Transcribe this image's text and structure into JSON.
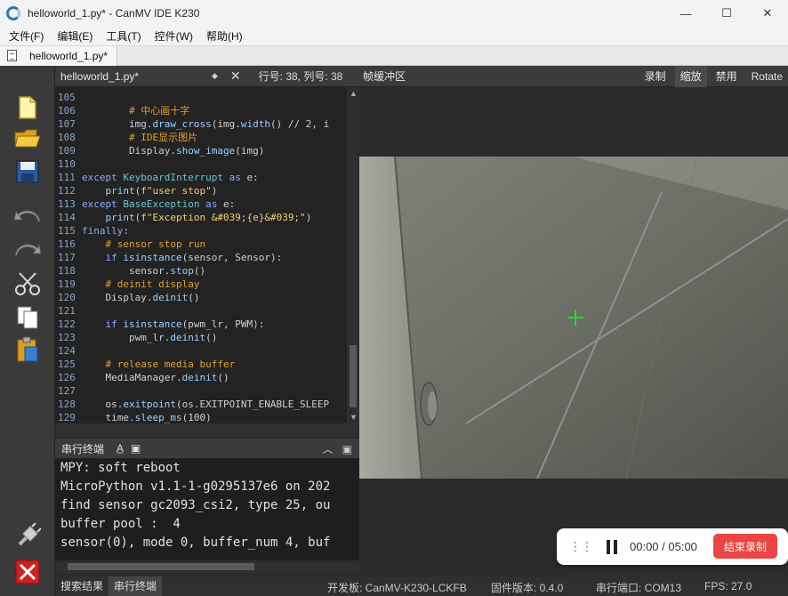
{
  "window": {
    "title": "helloworld_1.py* - CanMV IDE K230",
    "controls": {
      "minimize": "—",
      "maximize": "☐",
      "close": "✕"
    }
  },
  "menu": [
    {
      "label": "文件(F)"
    },
    {
      "label": "编辑(E)"
    },
    {
      "label": "工具(T)"
    },
    {
      "label": "控件(W)"
    },
    {
      "label": "帮助(H)"
    }
  ],
  "doc_tab": {
    "label": "helloworld_1.py*"
  },
  "editor": {
    "file_label": "helloworld_1.py*",
    "dropdown": "◆",
    "close": "✕",
    "position": "行号: 38, 列号: 38"
  },
  "code_lines": [
    {
      "n": "105",
      "html": ""
    },
    {
      "n": "106",
      "html": "        <span class='cm'># 中心画十字</span>"
    },
    {
      "n": "107",
      "html": "        img.<span class='fn'>draw_cross</span>(img.<span class='fn'>width</span>() // 2, i"
    },
    {
      "n": "108",
      "html": "        <span class='cm'># IDE显示图片</span>"
    },
    {
      "n": "109",
      "html": "        Display.<span class='fn'>show_image</span>(img)"
    },
    {
      "n": "110",
      "html": ""
    },
    {
      "n": "111",
      "html": "<span class='kw'>except</span> <span class='cls'>KeyboardInterrupt</span> <span class='kw'>as</span> e:"
    },
    {
      "n": "112",
      "html": "    <span class='fn'>print</span>(<span class='st'>f\"user stop\"</span>)"
    },
    {
      "n": "113",
      "html": "<span class='kw'>except</span> <span class='cls'>BaseException</span> <span class='kw'>as</span> e:"
    },
    {
      "n": "114",
      "html": "    <span class='fn'>print</span>(<span class='st'>f\"Exception &amp;#039;{e}&amp;#039;\"</span>)"
    },
    {
      "n": "115",
      "html": "<span class='kw'>finally</span>:"
    },
    {
      "n": "116",
      "html": "    <span class='cm'># sensor stop run</span>"
    },
    {
      "n": "117",
      "html": "    <span class='kw'>if</span> <span class='fn'>isinstance</span>(sensor, Sensor):"
    },
    {
      "n": "118",
      "html": "        sensor.<span class='fn'>stop</span>()"
    },
    {
      "n": "119",
      "html": "    <span class='cm'># deinit display</span>"
    },
    {
      "n": "120",
      "html": "    Display.<span class='fn'>deinit</span>()"
    },
    {
      "n": "121",
      "html": ""
    },
    {
      "n": "122",
      "html": "    <span class='kw'>if</span> <span class='fn'>isinstance</span>(pwm_lr, PWM):"
    },
    {
      "n": "123",
      "html": "        pwm_lr.<span class='fn'>deinit</span>()"
    },
    {
      "n": "124",
      "html": ""
    },
    {
      "n": "125",
      "html": "    <span class='cm'># release media buffer</span>"
    },
    {
      "n": "126",
      "html": "    MediaManager.<span class='fn'>deinit</span>()"
    },
    {
      "n": "127",
      "html": ""
    },
    {
      "n": "128",
      "html": "    os.<span class='fn'>exitpoint</span>(os.EXITPOINT_ENABLE_SLEEP"
    },
    {
      "n": "129",
      "html": "    time.<span class='fn'>sleep_ms</span>(100)"
    }
  ],
  "terminal": {
    "label": "串行终端",
    "lines": [
      "MPY: soft reboot",
      "MicroPython v1.1-1-g0295137e6 on 202",
      "find sensor gc2093_csi2, type 25, ou",
      "buffer pool :  4",
      "sensor(0), mode 0, buffer_num 4, buf"
    ]
  },
  "frame_buffer": {
    "label": "帧缓冲区",
    "buttons": [
      {
        "label": "录制",
        "active": false
      },
      {
        "label": "缩放",
        "active": true
      },
      {
        "label": "禁用",
        "active": false
      },
      {
        "label": "Rotate",
        "active": false
      }
    ]
  },
  "status": {
    "tabs": [
      {
        "label": "搜索结果",
        "active": false
      },
      {
        "label": "串行终端",
        "active": true
      }
    ],
    "board": "开发板: CanMV-K230-LCKFB",
    "firmware": "固件版本: 0.4.0",
    "serial": "串行端口: COM13",
    "fps": "FPS: 27.0"
  },
  "recording": {
    "time": "00:00 / 05:00",
    "stop_label": "结束录制"
  },
  "colors": {
    "crosshair": "#22dd22",
    "stop_button": "#ee4444"
  }
}
